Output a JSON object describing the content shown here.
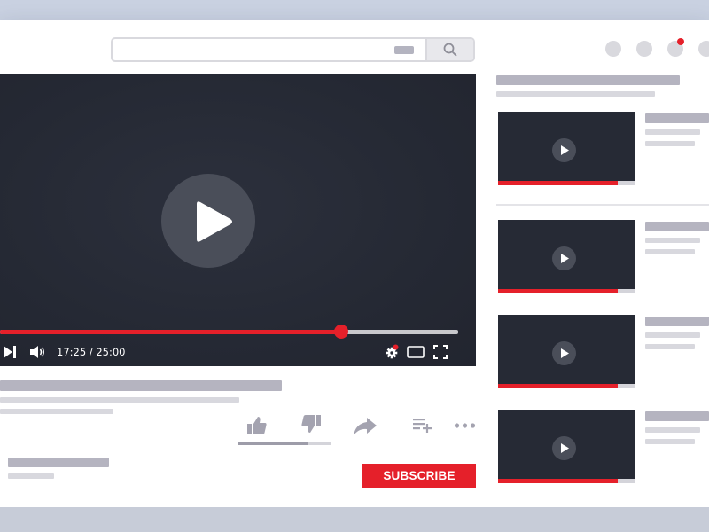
{
  "search": {
    "placeholder": "",
    "icon": "search-icon"
  },
  "header": {
    "icons": [
      "account-dot",
      "account-dot",
      "notification-dot",
      "account-dot"
    ]
  },
  "player": {
    "time": "17:25 / 25:00",
    "progress": 0.745,
    "controls": [
      "next-icon",
      "volume-icon",
      "settings-icon",
      "theater-icon",
      "fullscreen-icon"
    ],
    "settings_badge": true
  },
  "actions": {
    "icons": [
      "like-icon",
      "dislike-icon",
      "share-icon",
      "add-to-playlist-icon",
      "more-icon"
    ],
    "like_ratio": 0.76
  },
  "channel": {
    "subscribe_label": "SUBSCRIBE"
  },
  "recommendations": [
    {
      "progress": 0.87
    },
    {
      "progress": 0.87
    },
    {
      "progress": 0.87
    },
    {
      "progress": 0.87
    }
  ],
  "colors": {
    "accent": "#e5202a",
    "player_bg": "#252934",
    "placeholder_dark": "#b5b4c0",
    "placeholder_light": "#d8d8de"
  }
}
